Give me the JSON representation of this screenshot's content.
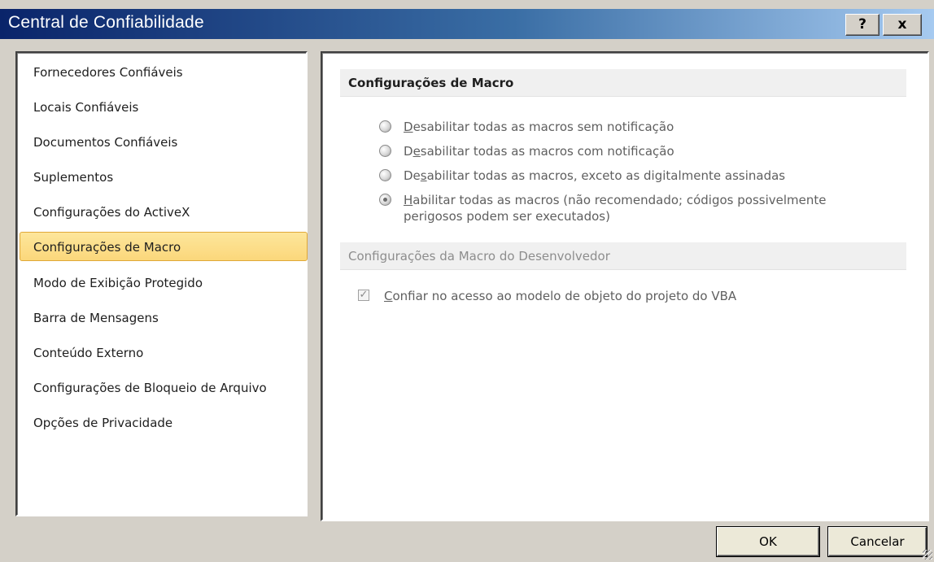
{
  "window": {
    "title": "Central de Confiabilidade",
    "help_label": "?",
    "close_label": "x"
  },
  "nav": {
    "items": [
      {
        "label": "Fornecedores Confiáveis"
      },
      {
        "label": "Locais Confiáveis"
      },
      {
        "label": "Documentos Confiáveis"
      },
      {
        "label": "Suplementos"
      },
      {
        "label": "Configurações do ActiveX"
      },
      {
        "label": "Configurações de Macro",
        "selected": true
      },
      {
        "label": "Modo de Exibição Protegido"
      },
      {
        "label": "Barra de Mensagens"
      },
      {
        "label": "Conteúdo Externo"
      },
      {
        "label": "Configurações de Bloqueio de Arquivo"
      },
      {
        "label": "Opções de Privacidade"
      }
    ]
  },
  "macro_settings": {
    "header": "Configurações de Macro",
    "options": [
      {
        "pre": "",
        "accel": "D",
        "post": "esabilitar todas as macros sem notificação",
        "checked": false
      },
      {
        "pre": "D",
        "accel": "e",
        "post": "sabilitar todas as macros com notificação",
        "checked": false
      },
      {
        "pre": "De",
        "accel": "s",
        "post": "abilitar todas as macros, exceto as digitalmente assinadas",
        "checked": false
      },
      {
        "pre": "",
        "accel": "H",
        "post": "abilitar todas as macros (não recomendado; códigos possivelmente",
        "line2": "perigosos podem ser executados)",
        "checked": true
      }
    ]
  },
  "developer_settings": {
    "header": "Configurações da Macro do Desenvolvedor",
    "vba_access": {
      "pre": "",
      "accel": "C",
      "post": "onfiar no acesso ao modelo de objeto do projeto do VBA",
      "checked": true
    }
  },
  "footer": {
    "ok_label": "OK",
    "cancel_label": "Cancelar"
  }
}
